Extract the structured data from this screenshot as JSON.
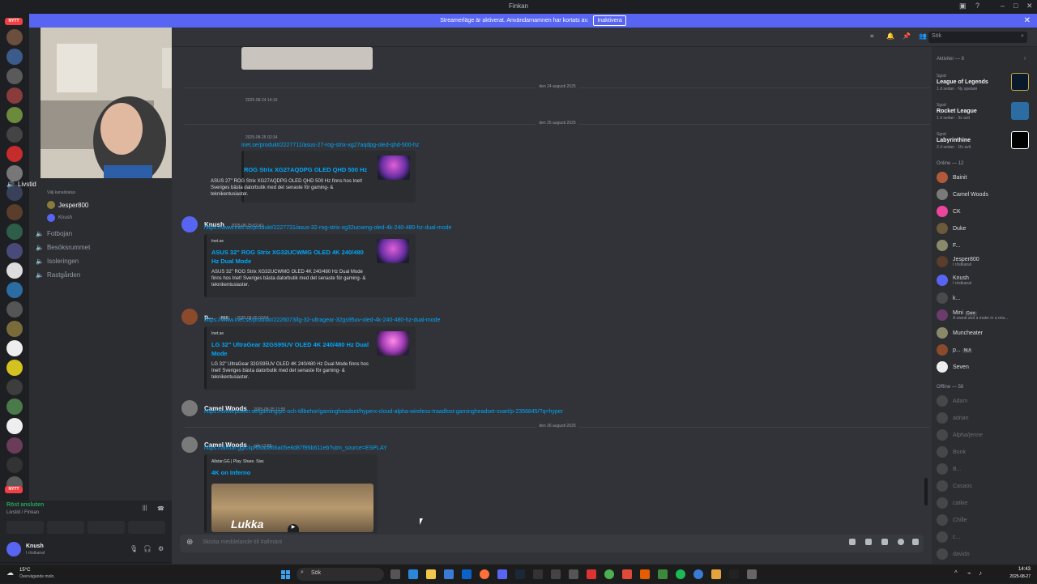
{
  "window": {
    "title": "Finkan"
  },
  "banner": {
    "text": "Streamerläge är aktiverat. Användarnamnen har kortats av.",
    "button": "Inaktivera"
  },
  "servers": {
    "nytt_top": "NYTT",
    "nytt_bottom": "NYTT",
    "badge1": "26",
    "badge2": "13"
  },
  "channels": {
    "voice_main": "Livstid",
    "voice_status": "Välj kanalstatus",
    "voice_users": [
      "Jesper800",
      "Knush"
    ],
    "others": [
      "Fotbojan",
      "Besöksrummet",
      "Isoleringen",
      "Rastgården"
    ]
  },
  "voice_connected": {
    "status": "Röst ansluten",
    "channel": "Livstid / Finkan"
  },
  "user": {
    "name": "Knush",
    "status": "I röstkanal"
  },
  "search": {
    "placeholder": "Sök"
  },
  "messages": {
    "date1": "den 24 augusti 2025",
    "ts0": "2025-08-24 14:16",
    "date2": "den 25 augusti 2025",
    "m1": {
      "ts": "2025-08-25 02:34",
      "link": "inet.se/produkt/2227711/asus-27-rog-strix-xg27aqdpg-oled-qhd-500-hz",
      "embed_title": "ROG Strix XG27AQDPG OLED QHD 500 Hz",
      "embed_desc": "ASUS 27\" ROG Strix XG27AQDPG OLED QHD 500 Hz finns hos Inet! Sveriges bästa datorbutik med det senaste för gaming- & teknikentusiaster."
    },
    "m2": {
      "author": "Knush",
      "ts": "2025-08-25 02:41",
      "link": "https://www.inet.se/produkt/2227731/asus-32-rog-strix-xg32ucwmg-oled-4k-240-480-hz-dual-mode",
      "site": "Inet.se",
      "embed_title": "ASUS 32\" ROG Strix XG32UCWMG OLED 4K 240/480 Hz Dual Mode",
      "embed_desc": "ASUS 32\" ROG Strix XG32UCWMG OLED 4K 240/480 Hz Dual Mode finns hos Inet! Sveriges bästa datorbutik med det senaste för gaming- & teknikentusiaster."
    },
    "m3": {
      "author": "p...",
      "tag": "NUI",
      "ts": "2025-08-25 02:54",
      "link": "https://www.inet.se/produkt/2226073/lg-32-ultragear-32gs95uv-oled-4k-240-480-hz-dual-mode",
      "site": "Inet.se",
      "embed_title": "LG 32\" UltraGear 32GS95UV OLED 4K 240/480 Hz Dual Mode",
      "embed_desc": "LG 32\" UltraGear 32GS95UV OLED 4K 240/480 Hz Dual Mode finns hos Inet! Sveriges bästa datorbutik med det senaste för gaming- & teknikentusiaster."
    },
    "m4": {
      "author": "Camel Woods",
      "ts": "2025-08-25 11:55",
      "link": "https://www.power.se/gaming/pc-och-tillbehor/gamingheadset/hyperx-cloud-alpha-wireless-traadlost-gamingheadset-svart/p-2356845/?q=hyper"
    },
    "date3": "den 26 augusti 2025",
    "m5": {
      "author": "Camel Woods",
      "ts": "igår 12:55",
      "link": "https://allstar.gg/clip/68ad866a05e8d87f95b611eb?utm_source=ESPLAY",
      "site": "Allstar.GG | Play. Share. Star.",
      "embed_title": "4K on Inferno",
      "overlay": "Lukka"
    },
    "composer_placeholder": "Skicka meddelande till #allmänt"
  },
  "members": {
    "activity_header": "Aktiviter — 8",
    "activities": [
      {
        "pre": "Sgod",
        "game": "League of Legends",
        "sub": "1 d sedan · Ny spelare"
      },
      {
        "pre": "Sgod",
        "game": "Rocket League",
        "sub": "1 d sedan · 3x avit"
      },
      {
        "pre": "Sgod",
        "game": "Labyrinthine",
        "sub": "2 d sedan · 1fx avit"
      }
    ],
    "online_header": "Online — 12",
    "online": [
      {
        "name": "Bainit",
        "sub": ""
      },
      {
        "name": "Camel Woods",
        "sub": ""
      },
      {
        "name": "CK",
        "sub": ""
      },
      {
        "name": "Duke",
        "sub": ""
      },
      {
        "name": "F...",
        "sub": ""
      },
      {
        "name": "Jesper800",
        "sub": "I röstkanal"
      },
      {
        "name": "Knush",
        "sub": "I röstkanal"
      },
      {
        "name": "k...",
        "sub": ""
      },
      {
        "name": "Mini",
        "sub": "A sweat and a make in a rela..."
      },
      {
        "name": "Muncheater",
        "sub": ""
      },
      {
        "name": "p...",
        "sub": ""
      },
      {
        "name": "Seven",
        "sub": ""
      }
    ],
    "mini_tag": "Core",
    "p_tag": "NUI",
    "offline_header": "Offline — 58",
    "offline": [
      "Adam",
      "adrian",
      "Alpha/jenne",
      "Bonk",
      "B...",
      "Casaos",
      "catkie",
      "Chille",
      "c...",
      "davido"
    ]
  },
  "taskbar": {
    "weather_temp": "15°C",
    "weather_desc": "Övervägande moln.",
    "search": "Sök",
    "time": "14:43",
    "date": "2025-08-27"
  },
  "colors": {
    "accent": "#5865f2",
    "link": "#00a8fc",
    "bg": "#313338",
    "sidebar": "#2b2d31"
  }
}
